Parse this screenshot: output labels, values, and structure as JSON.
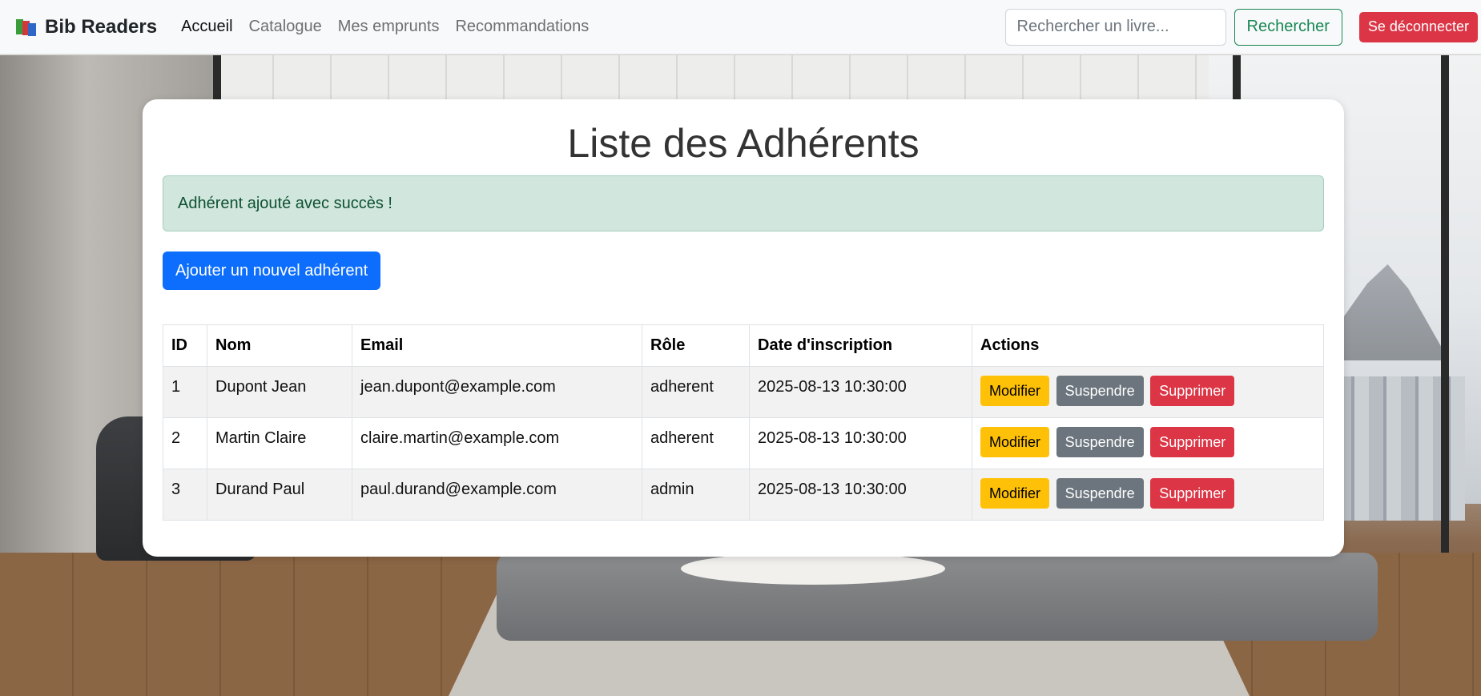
{
  "navbar": {
    "brand": "Bib Readers",
    "brand_icon": "books-icon",
    "links": [
      {
        "label": "Accueil",
        "active": true
      },
      {
        "label": "Catalogue",
        "active": false
      },
      {
        "label": "Mes emprunts",
        "active": false
      },
      {
        "label": "Recommandations",
        "active": false
      }
    ],
    "search_placeholder": "Rechercher un livre...",
    "search_button": "Rechercher",
    "logout_button": "Se déconnecter"
  },
  "main": {
    "title": "Liste des Adhérents",
    "alert": "Adhérent ajouté avec succès !",
    "add_button": "Ajouter un nouvel adhérent",
    "table": {
      "headers": [
        "ID",
        "Nom",
        "Email",
        "Rôle",
        "Date d'inscription",
        "Actions"
      ],
      "rows": [
        {
          "id": "1",
          "nom": "Dupont Jean",
          "email": "jean.dupont@example.com",
          "role": "adherent",
          "date": "2025-08-13 10:30:00"
        },
        {
          "id": "2",
          "nom": "Martin Claire",
          "email": "claire.martin@example.com",
          "role": "adherent",
          "date": "2025-08-13 10:30:00"
        },
        {
          "id": "3",
          "nom": "Durand Paul",
          "email": "paul.durand@example.com",
          "role": "admin",
          "date": "2025-08-13 10:30:00"
        }
      ],
      "actions": {
        "edit": "Modifier",
        "suspend": "Suspendre",
        "delete": "Supprimer"
      }
    }
  },
  "colors": {
    "primary": "#0d6efd",
    "success": "#198754",
    "danger": "#dc3545",
    "warning": "#ffc107",
    "secondary": "#6c757d",
    "alert_bg": "#d1e7dd"
  }
}
